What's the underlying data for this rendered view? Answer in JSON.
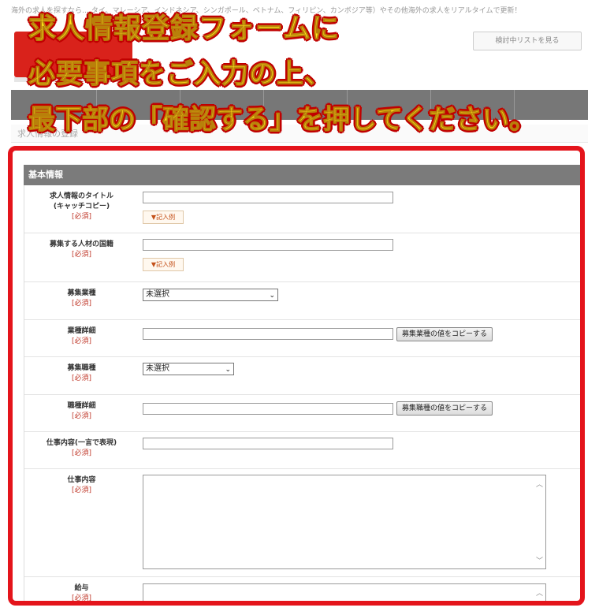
{
  "background_site": {
    "top_line": "海外の求人を探すなら… タイ、マレーシア、インドネシア、シンガポール、ベトナム、フィリピン、カンボジア等）やその他海外の求人をリアルタイムで更新！",
    "wishlist_button": "検討中リストを見る",
    "page_heading": "求人情報の登録"
  },
  "banner": {
    "line1": "求人情報登録フォームに",
    "line2": "必要事項をご入力の上、",
    "line3": "最下部の「確認する」を押してください。"
  },
  "form": {
    "section_title": "基本情報",
    "required_label": "[必須]",
    "example_label": "▼記入例",
    "rows": {
      "title": {
        "label": "求人情報のタイトル",
        "sub": "(キャッチコピー)"
      },
      "nationality": {
        "label": "募集する人材の国籍"
      },
      "industry": {
        "label": "募集業種",
        "select_value": "未選択"
      },
      "industry_detail": {
        "label": "業種詳細",
        "copy_button": "募集業種の値をコピーする"
      },
      "job_type": {
        "label": "募集職種",
        "select_value": "未選択"
      },
      "job_detail": {
        "label": "職種詳細",
        "copy_button": "募集職種の値をコピーする"
      },
      "job_summary": {
        "label": "仕事内容(一言で表現)"
      },
      "job_content": {
        "label": "仕事内容"
      },
      "salary": {
        "label": "給与"
      }
    }
  },
  "colors": {
    "frame_red": "#e4141b",
    "banner_yellow": "#ffe81a",
    "section_header_gray": "#7b7b7b",
    "required_red": "#c0392b"
  }
}
